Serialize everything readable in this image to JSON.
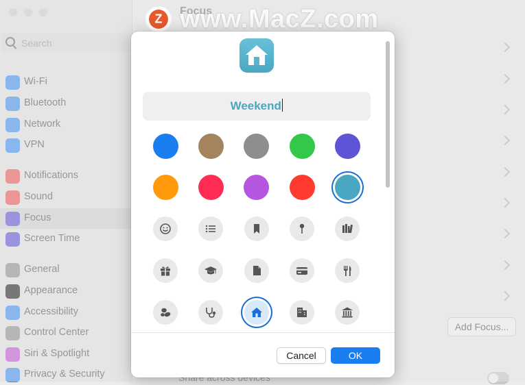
{
  "watermark": {
    "badge_letter": "Z",
    "text": "www.MacZ.com"
  },
  "window": {
    "title": "Focus"
  },
  "search": {
    "placeholder": "Search"
  },
  "sidebar": {
    "items": [
      {
        "label": "Wi-Fi",
        "icon": "wifi-icon",
        "color": "#3d8ef0"
      },
      {
        "label": "Bluetooth",
        "icon": "bluetooth-icon",
        "color": "#3d8ef0"
      },
      {
        "label": "Network",
        "icon": "globe-icon",
        "color": "#3d8ef0"
      },
      {
        "label": "VPN",
        "icon": "vpn-globe-icon",
        "color": "#3d8ef0"
      },
      {
        "label": "Notifications",
        "icon": "bell-icon",
        "color": "#ef5350"
      },
      {
        "label": "Sound",
        "icon": "speaker-icon",
        "color": "#ef5350"
      },
      {
        "label": "Focus",
        "icon": "moon-icon",
        "color": "#5b4fd6",
        "selected": true
      },
      {
        "label": "Screen Time",
        "icon": "hourglass-icon",
        "color": "#5b4fd6"
      },
      {
        "label": "General",
        "icon": "gear-icon",
        "color": "#8e8e93"
      },
      {
        "label": "Appearance",
        "icon": "appearance-icon",
        "color": "#1c1c1e"
      },
      {
        "label": "Accessibility",
        "icon": "accessibility-icon",
        "color": "#3d8ef0"
      },
      {
        "label": "Control Center",
        "icon": "control-center-icon",
        "color": "#8e8e93"
      },
      {
        "label": "Siri & Spotlight",
        "icon": "siri-icon",
        "color": "#c455d8"
      },
      {
        "label": "Privacy & Security",
        "icon": "hand-icon",
        "color": "#3d8ef0"
      }
    ]
  },
  "main": {
    "add_focus_label": "Add Focus...",
    "share_label": "Share across devices"
  },
  "dialog": {
    "header_icon": "house-icon",
    "accent_color": "#4aa7c2",
    "name_value": "Weekend",
    "colors": [
      "#1a7df0",
      "#a4845c",
      "#8e8e8e",
      "#34c84a",
      "#5e55d6",
      "#ff9a0a",
      "#ff2d55",
      "#b456e0",
      "#ff3b30",
      "#4aa7c2"
    ],
    "selected_color_index": 9,
    "symbols": [
      "smiley-icon",
      "list-icon",
      "bookmark-icon",
      "pin-icon",
      "books-icon",
      "gift-icon",
      "graduation-cap-icon",
      "document-icon",
      "credit-card-icon",
      "fork-knife-icon",
      "pills-icon",
      "stethoscope-icon",
      "house-icon",
      "building-icon",
      "bank-icon"
    ],
    "selected_symbol_index": 12,
    "cancel_label": "Cancel",
    "ok_label": "OK"
  }
}
